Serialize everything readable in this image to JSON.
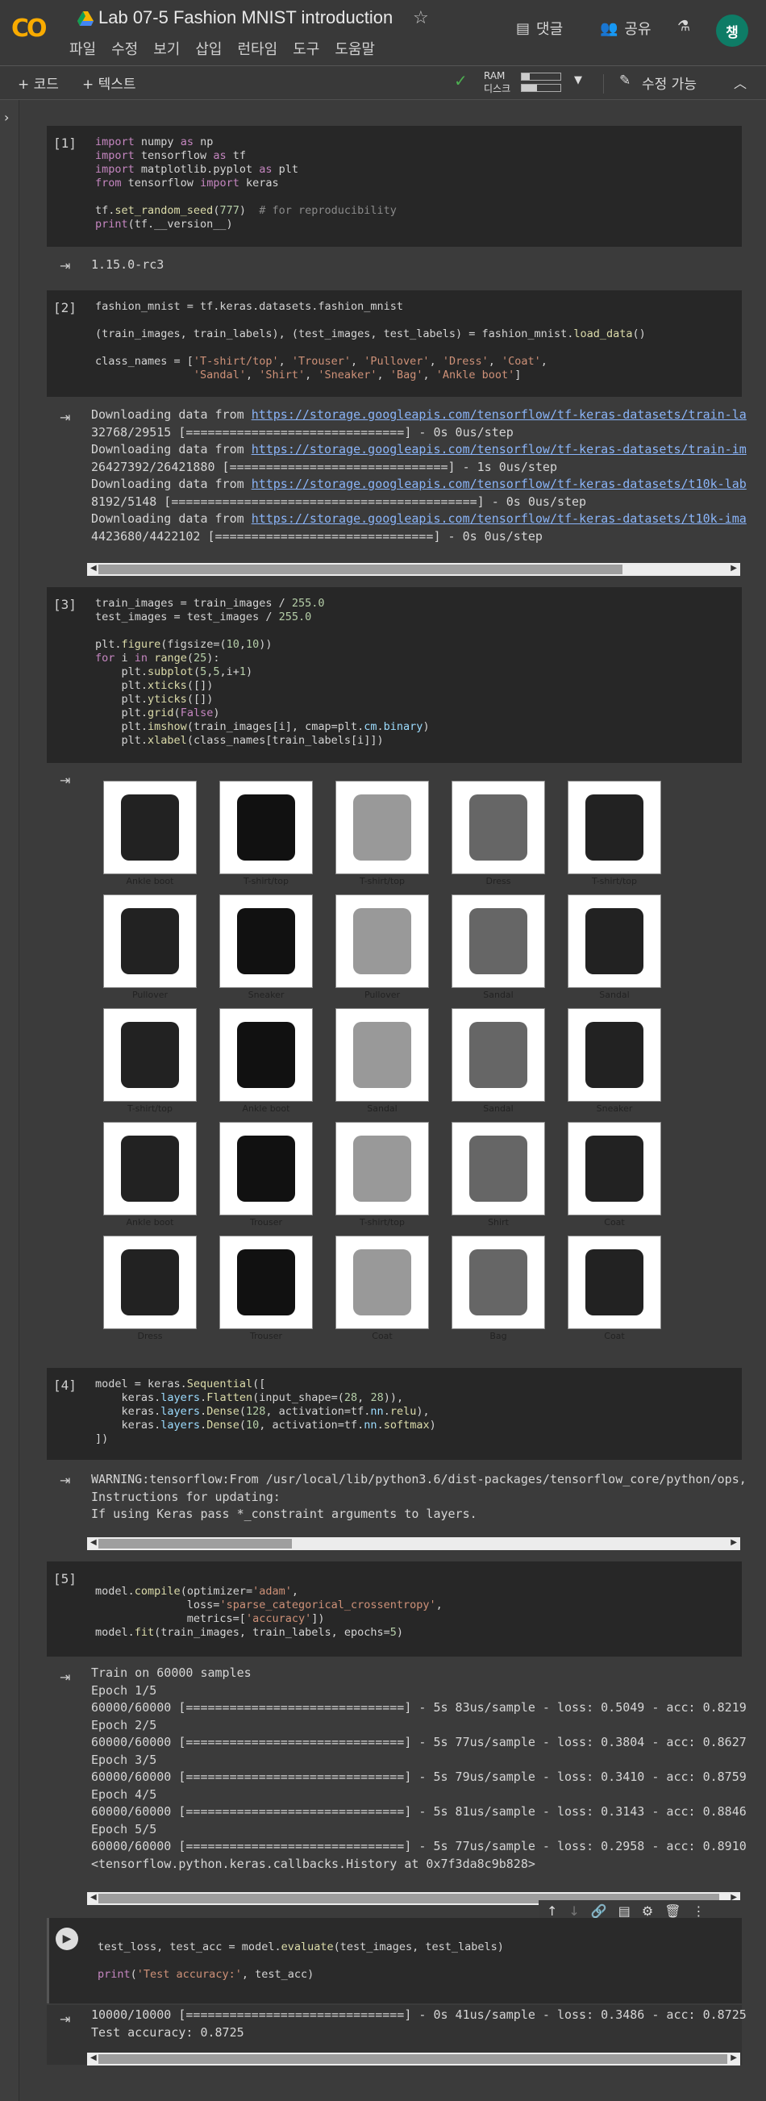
{
  "header": {
    "logo": "CO",
    "title": "Lab 07-5 Fashion MNIST introduction",
    "menu": [
      "파일",
      "수정",
      "보기",
      "삽입",
      "런타임",
      "도구",
      "도움말"
    ],
    "comment": "댓글",
    "share": "공유",
    "avatar": "챙"
  },
  "toolbar": {
    "code": "+ 코드",
    "text": "+ 텍스트",
    "ram": "RAM",
    "disk": "디스크",
    "edit": "수정 가능"
  },
  "cells": {
    "c1": {
      "label": "[1]",
      "out": "1.15.0-rc3"
    },
    "c2": {
      "label": "[2]",
      "out": [
        "Downloading data from ",
        "https://storage.googleapis.com/tensorflow/tf-keras-datasets/train-la",
        "32768/29515 [==============================] - 0s 0us/step",
        "Downloading data from ",
        "https://storage.googleapis.com/tensorflow/tf-keras-datasets/train-im",
        "26427392/26421880 [==============================] - 1s 0us/step",
        "Downloading data from ",
        "https://storage.googleapis.com/tensorflow/tf-keras-datasets/t10k-lab",
        "8192/5148 [==========================================] - 0s 0us/step",
        "Downloading data from ",
        "https://storage.googleapis.com/tensorflow/tf-keras-datasets/t10k-ima",
        "4423680/4422102 [==============================] - 0s 0us/step"
      ]
    },
    "c3": {
      "label": "[3]"
    },
    "c4": {
      "label": "[4]",
      "out": [
        "WARNING:tensorflow:From /usr/local/lib/python3.6/dist-packages/tensorflow_core/python/ops,",
        "Instructions for updating:",
        "If using Keras pass *_constraint arguments to layers."
      ]
    },
    "c5": {
      "label": "[5]",
      "out": [
        "Train on 60000 samples",
        "Epoch 1/5",
        "60000/60000 [==============================] - 5s 83us/sample - loss: 0.5049 - acc: 0.8219",
        "Epoch 2/5",
        "60000/60000 [==============================] - 5s 77us/sample - loss: 0.3804 - acc: 0.8627",
        "Epoch 3/5",
        "60000/60000 [==============================] - 5s 79us/sample - loss: 0.3410 - acc: 0.8759",
        "Epoch 4/5",
        "60000/60000 [==============================] - 5s 81us/sample - loss: 0.3143 - acc: 0.8846",
        "Epoch 5/5",
        "60000/60000 [==============================] - 5s 77us/sample - loss: 0.2958 - acc: 0.8910",
        "<tensorflow.python.keras.callbacks.History at 0x7f3da8c9b828>"
      ]
    },
    "c6": {
      "out": [
        "10000/10000 [==============================] - 0s 41us/sample - loss: 0.3486 - acc: 0.8725",
        "Test accuracy: 0.8725"
      ]
    }
  },
  "grid_labels": [
    "Ankle boot",
    "T-shirt/top",
    "T-shirt/top",
    "Dress",
    "T-shirt/top",
    "Pullover",
    "Sneaker",
    "Pullover",
    "Sandal",
    "Sandal",
    "T-shirt/top",
    "Ankle boot",
    "Sandal",
    "Sandal",
    "Sneaker",
    "Ankle boot",
    "Trouser",
    "T-shirt/top",
    "Shirt",
    "Coat",
    "Dress",
    "Trouser",
    "Coat",
    "Bag",
    "Coat"
  ]
}
